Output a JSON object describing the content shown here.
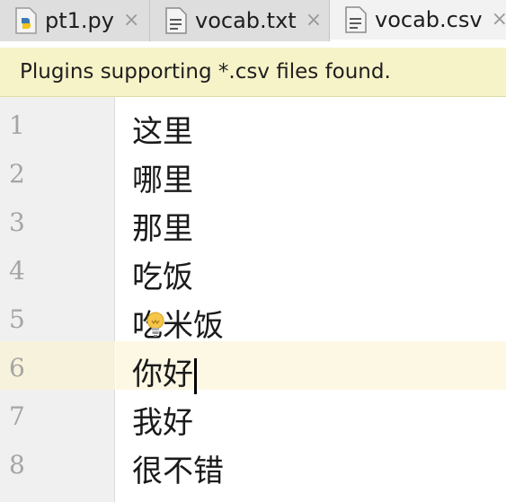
{
  "tabs": [
    {
      "label": "pt1.py",
      "icon": "python-file-icon",
      "active": false
    },
    {
      "label": "vocab.txt",
      "icon": "text-file-icon",
      "active": false
    },
    {
      "label": "vocab.csv",
      "icon": "text-file-icon",
      "active": true
    }
  ],
  "close_glyph": "×",
  "notification": {
    "text": "Plugins supporting *.csv files found."
  },
  "editor": {
    "lines": [
      {
        "number": "1",
        "text": "这里"
      },
      {
        "number": "2",
        "text": "哪里"
      },
      {
        "number": "3",
        "text": "那里"
      },
      {
        "number": "4",
        "text": "吃饭"
      },
      {
        "number": "5",
        "text": "吃米饭"
      },
      {
        "number": "6",
        "text": "你好"
      },
      {
        "number": "7",
        "text": "我好"
      },
      {
        "number": "8",
        "text": "很不错"
      }
    ],
    "current_line": "6"
  },
  "colors": {
    "banner": "#f7f3c8",
    "current_line": "#fdf8e4",
    "gutter": "#f0f0f0"
  }
}
